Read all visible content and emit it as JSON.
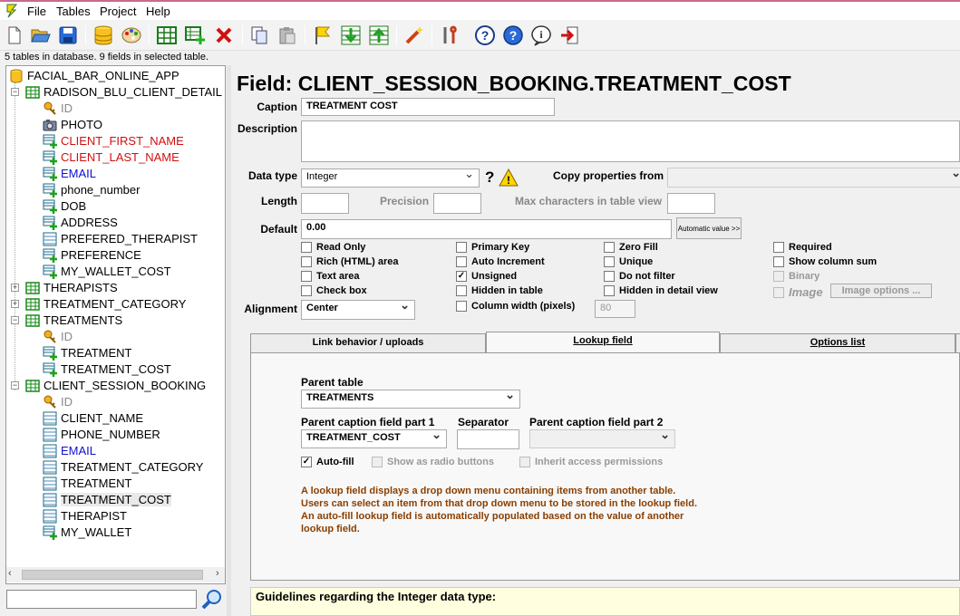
{
  "menu": [
    "File",
    "Tables",
    "Project",
    "Help"
  ],
  "toolbar_icons": [
    "new-icon",
    "open-icon",
    "save-icon",
    "database-icon",
    "theme-icon",
    "table-icon",
    "add-field-icon",
    "delete-icon",
    "copy-icon",
    "paste-icon",
    "flag-icon",
    "import-icon",
    "export-icon",
    "wand-icon",
    "tools-icon",
    "help-icon",
    "about-icon",
    "info-icon",
    "exit-icon"
  ],
  "status": "5 tables in database. 9 fields in selected table.",
  "tree": {
    "root": "FACIAL_BAR_ONLINE_APP",
    "tables": [
      {
        "name": "RADISON_BLU_CLIENT_DETAIL",
        "expanded": true,
        "fields": [
          {
            "name": "ID",
            "style": "gray",
            "icon": "key"
          },
          {
            "name": "PHOTO",
            "style": "normal",
            "icon": "photo"
          },
          {
            "name": "CLIENT_FIRST_NAME",
            "style": "red",
            "icon": "field-add"
          },
          {
            "name": "CLIENT_LAST_NAME",
            "style": "red",
            "icon": "field-add"
          },
          {
            "name": "EMAIL",
            "style": "blue",
            "icon": "field-add"
          },
          {
            "name": "phone_number",
            "style": "normal",
            "icon": "field-add"
          },
          {
            "name": "DOB",
            "style": "normal",
            "icon": "field-add"
          },
          {
            "name": "ADDRESS",
            "style": "normal",
            "icon": "field-add"
          },
          {
            "name": "PREFERED_THERAPIST",
            "style": "normal",
            "icon": "lookup"
          },
          {
            "name": "PREFERENCE",
            "style": "normal",
            "icon": "field-add"
          },
          {
            "name": "MY_WALLET_COST",
            "style": "normal",
            "icon": "field-add"
          }
        ]
      },
      {
        "name": "THERAPISTS",
        "expanded": false,
        "fields": []
      },
      {
        "name": "TREATMENT_CATEGORY",
        "expanded": false,
        "fields": []
      },
      {
        "name": "TREATMENTS",
        "expanded": true,
        "fields": [
          {
            "name": "ID",
            "style": "gray",
            "icon": "key"
          },
          {
            "name": "TREATMENT",
            "style": "normal",
            "icon": "field-add"
          },
          {
            "name": "TREATMENT_COST",
            "style": "normal",
            "icon": "field-add"
          }
        ]
      },
      {
        "name": "CLIENT_SESSION_BOOKING",
        "expanded": true,
        "fields": [
          {
            "name": "ID",
            "style": "gray",
            "icon": "key"
          },
          {
            "name": "CLIENT_NAME",
            "style": "normal",
            "icon": "lookup"
          },
          {
            "name": "PHONE_NUMBER",
            "style": "normal",
            "icon": "lookup"
          },
          {
            "name": "EMAIL",
            "style": "blue",
            "icon": "lookup"
          },
          {
            "name": "TREATMENT_CATEGORY",
            "style": "normal",
            "icon": "lookup"
          },
          {
            "name": "TREATMENT",
            "style": "normal",
            "icon": "lookup"
          },
          {
            "name": "TREATMENT_COST",
            "style": "normal",
            "icon": "lookup",
            "selected": true
          },
          {
            "name": "THERAPIST",
            "style": "normal",
            "icon": "lookup"
          },
          {
            "name": "MY_WALLET",
            "style": "normal",
            "icon": "field-add"
          }
        ]
      }
    ]
  },
  "field": {
    "title": "Field: CLIENT_SESSION_BOOKING.TREATMENT_COST",
    "caption_label": "Caption",
    "caption_value": "TREATMENT COST",
    "description_label": "Description",
    "datatype_label": "Data type",
    "datatype_value": "Integer",
    "copy_label": "Copy properties from",
    "length_label": "Length",
    "precision_label": "Precision",
    "maxchars_label": "Max characters in table view",
    "default_label": "Default",
    "default_value": "0.00",
    "auto_value_button": "Automatic value >>",
    "alignment_label": "Alignment",
    "alignment_value": "Center",
    "column_width_value": "80",
    "image_options_button": "Image options ...",
    "checkboxes": [
      {
        "label": "Read Only",
        "checked": false
      },
      {
        "label": "Rich (HTML) area",
        "checked": false
      },
      {
        "label": "Text area",
        "checked": false
      },
      {
        "label": "Check box",
        "checked": false
      },
      {
        "label": "Primary Key",
        "checked": false
      },
      {
        "label": "Auto Increment",
        "checked": false
      },
      {
        "label": "Unsigned",
        "checked": true
      },
      {
        "label": "Hidden in table",
        "checked": false
      },
      {
        "label": "Column width (pixels)",
        "checked": false
      },
      {
        "label": "Zero Fill",
        "checked": false
      },
      {
        "label": "Unique",
        "checked": false
      },
      {
        "label": "Do not filter",
        "checked": false
      },
      {
        "label": "Hidden in detail view",
        "checked": false
      },
      {
        "label": "Required",
        "checked": false
      },
      {
        "label": "Show column sum",
        "checked": false
      },
      {
        "label": "Binary",
        "checked": false,
        "disabled": true
      },
      {
        "label": "Image",
        "checked": false,
        "disabled": true
      }
    ]
  },
  "tabs": [
    "Link behavior / uploads",
    "Lookup field",
    "Options list"
  ],
  "lookup": {
    "parent_table_label": "Parent table",
    "parent_table_value": "TREATMENTS",
    "caption1_label": "Parent caption field part 1",
    "caption1_value": "TREATMENT_COST",
    "separator_label": "Separator",
    "separator_value": "",
    "caption2_label": "Parent caption field part 2",
    "caption2_value": "",
    "autofill_label": "Auto-fill",
    "radio_label": "Show as radio buttons",
    "inherit_label": "Inherit access permissions",
    "help": "A lookup field displays a drop down menu containing items from another table. Users can select an item from that drop down menu to be stored in the lookup field. An auto-fill lookup field is automatically populated based on the value of another lookup field."
  },
  "guidelines_title": "Guidelines regarding the Integer data type:"
}
